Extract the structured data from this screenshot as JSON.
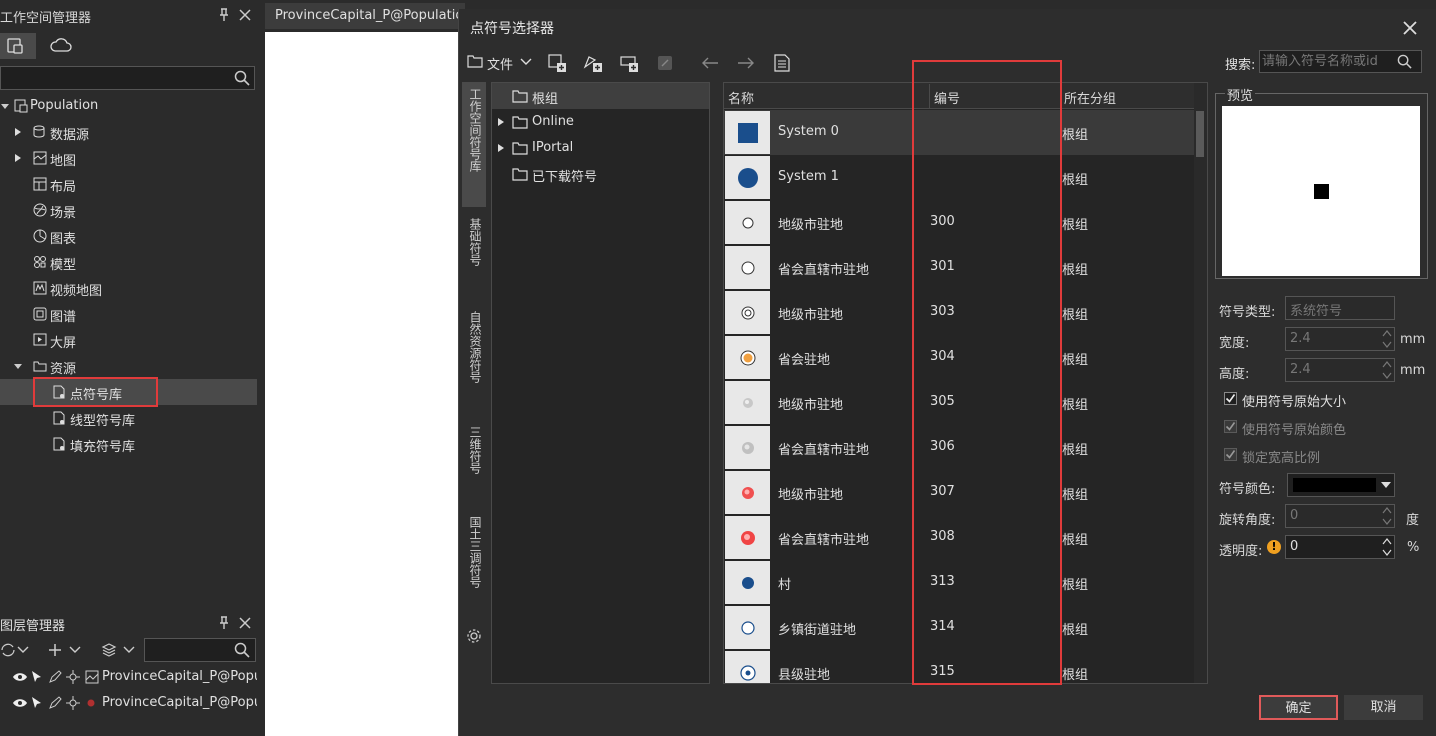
{
  "workspace": {
    "title": "工作空间管理器",
    "tree": [
      {
        "label": "Population"
      },
      {
        "label": "数据源"
      },
      {
        "label": "地图"
      },
      {
        "label": "布局"
      },
      {
        "label": "场景"
      },
      {
        "label": "图表"
      },
      {
        "label": "模型"
      },
      {
        "label": "视频地图"
      },
      {
        "label": "图谱"
      },
      {
        "label": "大屏"
      },
      {
        "label": "资源"
      },
      {
        "label": "点符号库"
      },
      {
        "label": "线型符号库"
      },
      {
        "label": "填充符号库"
      }
    ]
  },
  "layers": {
    "title": "图层管理器",
    "items": [
      {
        "label": "ProvinceCapital_P@Population"
      },
      {
        "label": "ProvinceCapital_P@Population"
      }
    ]
  },
  "document": {
    "tab_label": "ProvinceCapital_P@Population"
  },
  "dialog": {
    "title": "点符号选择器",
    "file_menu": "文件",
    "search_label": "搜索:",
    "search_placeholder": "请输入符号名称或id",
    "side_tabs": [
      "工作空间符号库",
      "基础符号",
      "自然资源符号",
      "三维符号",
      "国土三调符号"
    ],
    "groups": [
      {
        "label": "根组"
      },
      {
        "label": "Online"
      },
      {
        "label": "IPortal"
      },
      {
        "label": "已下载符号"
      }
    ],
    "table": {
      "columns": [
        "名称",
        "编号",
        "所在分组"
      ],
      "rows": [
        {
          "name": "System 0",
          "id": "",
          "group": "根组",
          "icon": "filled-square"
        },
        {
          "name": "System 1",
          "id": "",
          "group": "根组",
          "icon": "filled-circle"
        },
        {
          "name": "地级市驻地",
          "id": "300",
          "group": "根组",
          "icon": "hollow-circle"
        },
        {
          "name": "省会直辖市驻地",
          "id": "301",
          "group": "根组",
          "icon": "hollow-circle"
        },
        {
          "name": "地级市驻地",
          "id": "303",
          "group": "根组",
          "icon": "double-circle"
        },
        {
          "name": "省会驻地",
          "id": "304",
          "group": "根组",
          "icon": "orange-dot-circle"
        },
        {
          "name": "地级市驻地",
          "id": "305",
          "group": "根组",
          "icon": "grey-sphere"
        },
        {
          "name": "省会直辖市驻地",
          "id": "306",
          "group": "根组",
          "icon": "grey-sphere"
        },
        {
          "name": "地级市驻地",
          "id": "307",
          "group": "根组",
          "icon": "red-sphere"
        },
        {
          "name": "省会直辖市驻地",
          "id": "308",
          "group": "根组",
          "icon": "red-sphere"
        },
        {
          "name": "村",
          "id": "313",
          "group": "根组",
          "icon": "blue-dot"
        },
        {
          "name": "乡镇街道驻地",
          "id": "314",
          "group": "根组",
          "icon": "blue-ring"
        },
        {
          "name": "县级驻地",
          "id": "315",
          "group": "根组",
          "icon": "blue-dot-ring"
        }
      ]
    },
    "preview_label": "预览",
    "props": {
      "symbol_type_label": "符号类型:",
      "symbol_type_value": "系统符号",
      "width_label": "宽度:",
      "width_value": "2.4",
      "height_label": "高度:",
      "height_value": "2.4",
      "unit_mm": "mm",
      "use_original_size": "使用符号原始大小",
      "use_original_color": "使用符号原始颜色",
      "lock_aspect": "锁定宽高比例",
      "color_label": "符号颜色:",
      "symbol_color": "#000000",
      "rotation_label": "旋转角度:",
      "rotation_value": "0",
      "rotation_unit": "度",
      "transparency_label": "透明度:",
      "transparency_value": "0",
      "transparency_unit": "%"
    },
    "ok": "确定",
    "cancel": "取消"
  },
  "colors": {
    "highlight_red": "#e03b3b",
    "symbol_blue": "#1a4e8c"
  }
}
